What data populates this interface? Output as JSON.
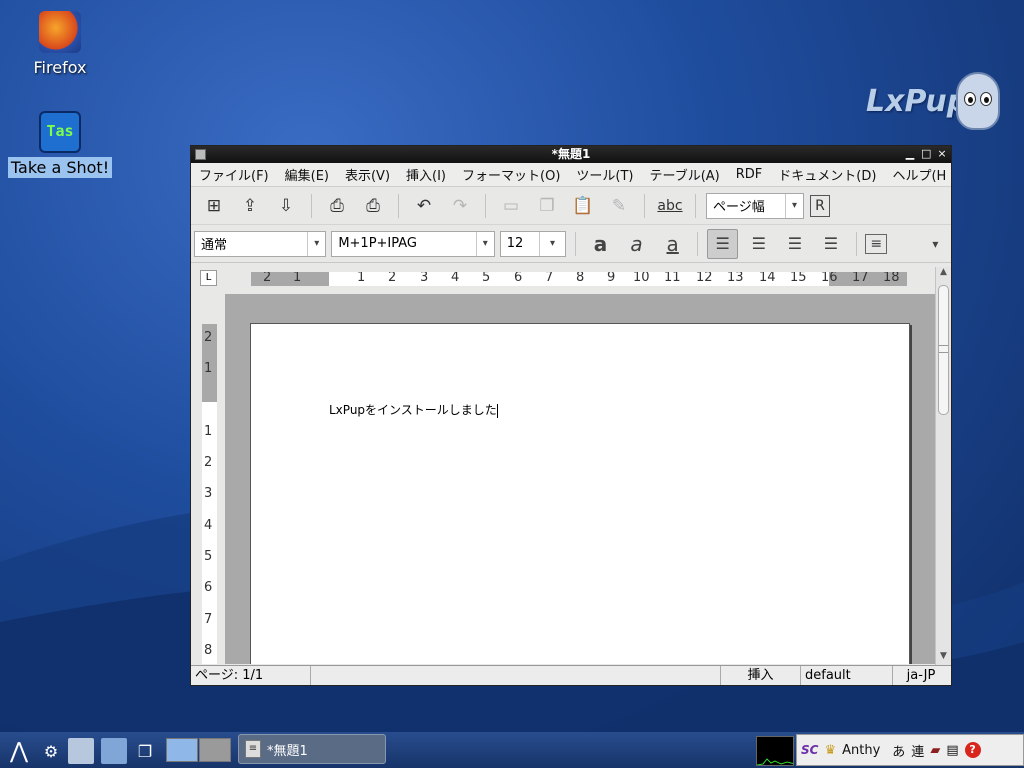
{
  "desktop": {
    "icons": [
      {
        "label": "Firefox",
        "icon": "firefox-icon"
      },
      {
        "label": "Take a Shot!",
        "icon": "screenshot-app-icon"
      }
    ],
    "brand": "LxPup"
  },
  "window": {
    "title": "*無題1",
    "controls": {
      "minimize": "▁",
      "maximize": "□",
      "close": "×"
    },
    "menu": [
      "ファイル(F)",
      "編集(E)",
      "表示(V)",
      "挿入(I)",
      "フォーマット(O)",
      "ツール(T)",
      "テーブル(A)",
      "RDF",
      "ドキュメント(D)",
      "ヘルプ(H"
    ],
    "toolbar": {
      "zoom_value": "ページ幅",
      "spell_label": "abc"
    },
    "format": {
      "style_value": "通常",
      "font_value": "M+1P+IPAG",
      "size_value": "12"
    },
    "ruler": {
      "corner": "L",
      "h_numbers": [
        "2",
        "1",
        "1",
        "2",
        "3",
        "4",
        "5",
        "6",
        "7",
        "8",
        "9",
        "10",
        "11",
        "12",
        "13",
        "14",
        "15",
        "16",
        "17",
        "18"
      ],
      "v_numbers": [
        "2",
        "1",
        "1",
        "2",
        "3",
        "4",
        "5",
        "6",
        "7",
        "8"
      ]
    },
    "document": {
      "text": "LxPupをインストールしました"
    },
    "status": {
      "page": "ページ: 1/1",
      "mode": "挿入",
      "style": "default",
      "lang": "ja-JP"
    }
  },
  "taskbar": {
    "task_label": "*無題1",
    "tray": {
      "ime_name": "Anthy",
      "kana": "あ",
      "conv": "連",
      "help": "?"
    }
  },
  "colors": {
    "desktop_blue": "#1f4d9e",
    "titlebar": "#1a1a1a",
    "tray_help_red": "#d9261c"
  }
}
